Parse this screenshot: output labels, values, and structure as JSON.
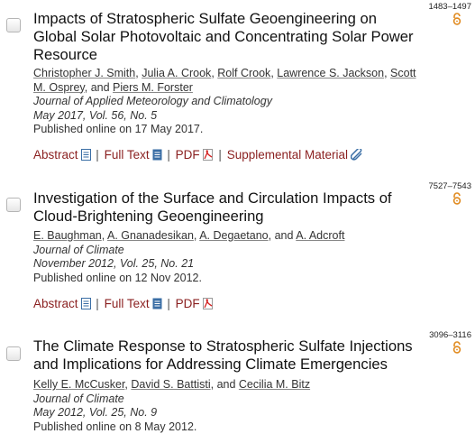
{
  "results": [
    {
      "pages": "1483–1497",
      "title": "Impacts of Stratospheric Sulfate Geoengineering on Global Solar Photovoltaic and Concentrating Solar Power Resource",
      "authors": [
        "Christopher J. Smith",
        "Julia A. Crook",
        "Rolf Crook",
        "Lawrence S. Jackson",
        "Scott M. Osprey",
        "Piers M. Forster"
      ],
      "and_word": "and",
      "journal": "Journal of Applied Meteorology and Climatology",
      "volume": "May 2017, Vol. 56, No. 5",
      "published": "Published online on 17 May 2017.",
      "links": [
        "Abstract",
        "Full Text",
        "PDF",
        "Supplemental Material"
      ]
    },
    {
      "pages": "7527–7543",
      "title": "Investigation of the Surface and Circulation Impacts of Cloud-Brightening Geoengineering",
      "authors": [
        "E. Baughman",
        "A. Gnanadesikan",
        "A. Degaetano",
        "A. Adcroft"
      ],
      "and_word": "and",
      "journal": "Journal of Climate",
      "volume": "November 2012, Vol. 25, No. 21",
      "published": "Published online on 12 Nov 2012.",
      "links": [
        "Abstract",
        "Full Text",
        "PDF"
      ]
    },
    {
      "pages": "3096–3116",
      "title": "The Climate Response to Stratospheric Sulfate Injections and Implications for Addressing Climate Emergencies",
      "authors": [
        "Kelly E. McCusker",
        "David S. Battisti",
        "Cecilia M. Bitz"
      ],
      "and_word": "and",
      "journal": "Journal of Climate",
      "volume": "May 2012, Vol. 25, No. 9",
      "published": "Published online on 8 May 2012."
    }
  ],
  "separator": "|",
  "colors": {
    "link": "#8a1f1f",
    "open_access": "#e08a1e",
    "doc_icon": "#3a6ea5"
  }
}
